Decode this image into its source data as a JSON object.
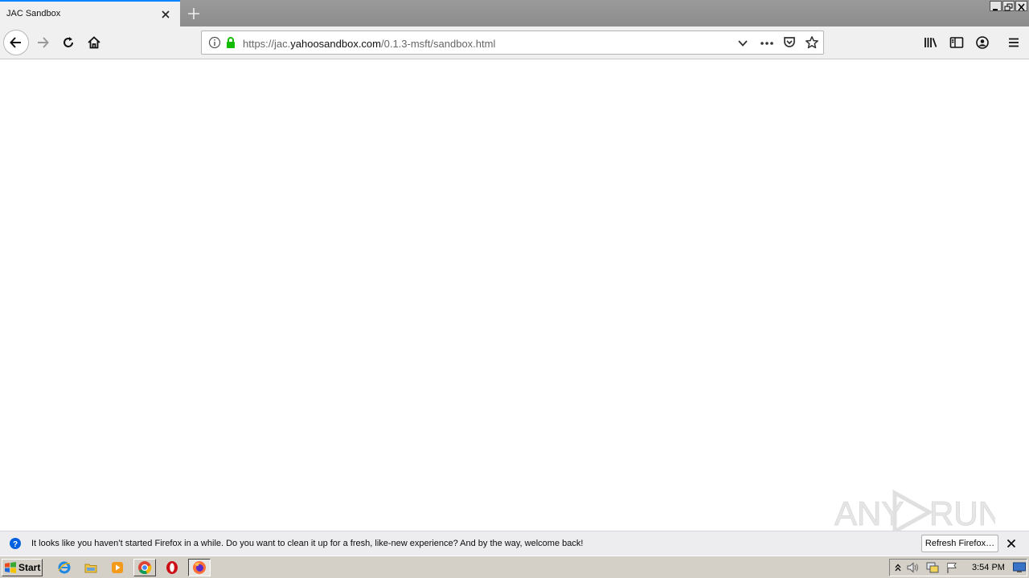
{
  "browser": {
    "tab_title": "JAC Sandbox",
    "url_prefix": "https://jac.",
    "url_host": "yahoosandbox.com",
    "url_path": "/0.1.3-msft/sandbox.html"
  },
  "notification": {
    "message": "It looks like you haven’t started Firefox in a while. Do you want to clean it up for a fresh, like-new experience? And by the way, welcome back!",
    "button_label": "Refresh Firefox…"
  },
  "taskbar": {
    "start_label": "Start",
    "clock": "3:54 PM",
    "apps": [
      "internet-explorer",
      "file-explorer",
      "media-player",
      "chrome",
      "opera",
      "firefox"
    ]
  },
  "watermark": "ANY RUN",
  "colors": {
    "accent": "#0a84ff",
    "secure_lock": "#12bc00",
    "taskbar": "#d4d0c8"
  }
}
